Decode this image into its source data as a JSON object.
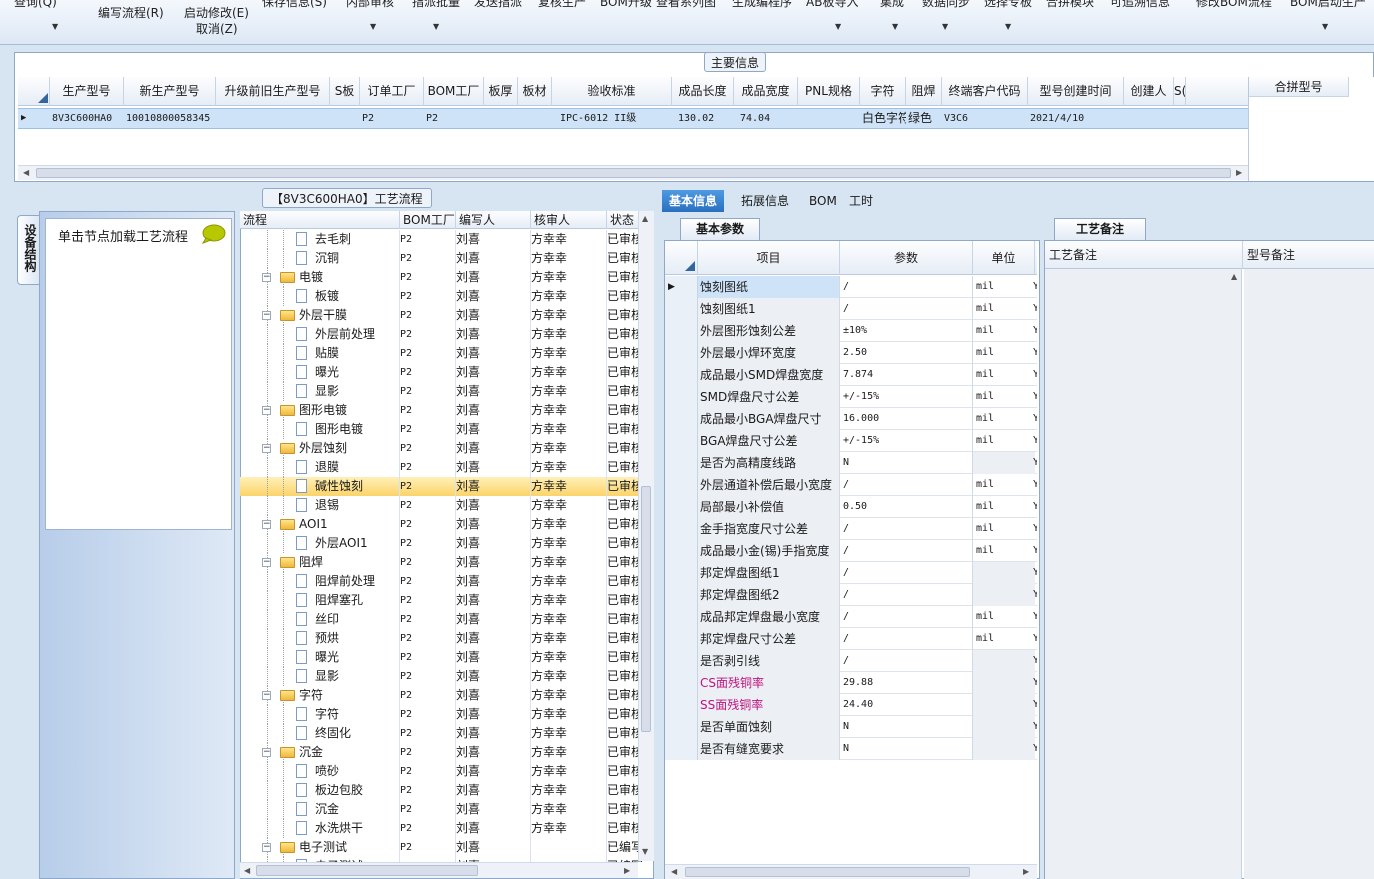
{
  "ribbon": {
    "top_partial": [
      "查询(Q)",
      "保存信息(S)",
      "内部审核",
      "指派批量",
      "发送指派",
      "复核生产",
      "BOM升级",
      "查看系列图",
      "生成编程序",
      "AB板导入",
      "集成",
      "数据同步",
      "选择专板",
      "合拼模块",
      "可追溯信息",
      "修改BOM流程",
      "BOM启动生产"
    ],
    "write_flow": "编写流程(R)",
    "start_modify": "启动修改(E)",
    "cancel": "取消(Z)"
  },
  "main_info": {
    "title": "主要信息",
    "columns": [
      "生产型号",
      "新生产型号",
      "升级前旧生产型号",
      "S板",
      "订单工厂",
      "BOM工厂",
      "板厚",
      "板材",
      "验收标准",
      "成品长度",
      "成品宽度",
      "PNL规格",
      "字符",
      "阻焊",
      "终端客户代码",
      "型号创建时间",
      "创建人",
      "S("
    ],
    "row": {
      "prod_no": "8V3C600HA0",
      "new_prod_no": "10010800058345",
      "old_prod_no": "",
      "s_board": "",
      "order_factory": "P2",
      "bom_factory": "P2",
      "thickness": "",
      "material": "",
      "standard": "IPC-6012 II级",
      "length": "130.02",
      "width": "74.04",
      "pnl": "",
      "char": "白色字符",
      "mask": "绿色",
      "customer_code": "V3C6",
      "created": "2021/4/10",
      "creator": ""
    },
    "merge_col_title": "合拼型号"
  },
  "left_panel": {
    "tab_label": "设备结构",
    "click_hint": "单击节点加载工艺流程"
  },
  "process": {
    "title": "【8V3C600HA0】工艺流程",
    "columns": [
      "流程",
      "BOM工厂",
      "编写人",
      "核审人",
      "状态"
    ],
    "rows": [
      {
        "name": "去毛刺",
        "type": "doc",
        "level": 2,
        "bom": "P2",
        "writer": "刘喜",
        "reviewer": "方幸幸",
        "status": "已审核"
      },
      {
        "name": "沉铜",
        "type": "doc",
        "level": 2,
        "bom": "P2",
        "writer": "刘喜",
        "reviewer": "方幸幸",
        "status": "已审核"
      },
      {
        "name": "电镀",
        "type": "folder",
        "level": 1,
        "bom": "P2",
        "writer": "刘喜",
        "reviewer": "方幸幸",
        "status": "已审核"
      },
      {
        "name": "板镀",
        "type": "doc",
        "level": 2,
        "bom": "P2",
        "writer": "刘喜",
        "reviewer": "方幸幸",
        "status": "已审核"
      },
      {
        "name": "外层干膜",
        "type": "folder",
        "level": 1,
        "bom": "P2",
        "writer": "刘喜",
        "reviewer": "方幸幸",
        "status": "已审核"
      },
      {
        "name": "外层前处理",
        "type": "doc",
        "level": 2,
        "bom": "P2",
        "writer": "刘喜",
        "reviewer": "方幸幸",
        "status": "已审核"
      },
      {
        "name": "贴膜",
        "type": "doc",
        "level": 2,
        "bom": "P2",
        "writer": "刘喜",
        "reviewer": "方幸幸",
        "status": "已审核"
      },
      {
        "name": "曝光",
        "type": "doc",
        "level": 2,
        "bom": "P2",
        "writer": "刘喜",
        "reviewer": "方幸幸",
        "status": "已审核"
      },
      {
        "name": "显影",
        "type": "doc",
        "level": 2,
        "bom": "P2",
        "writer": "刘喜",
        "reviewer": "方幸幸",
        "status": "已审核"
      },
      {
        "name": "图形电镀",
        "type": "folder",
        "level": 1,
        "bom": "P2",
        "writer": "刘喜",
        "reviewer": "方幸幸",
        "status": "已审核"
      },
      {
        "name": "图形电镀",
        "type": "doc",
        "level": 2,
        "bom": "P2",
        "writer": "刘喜",
        "reviewer": "方幸幸",
        "status": "已审核"
      },
      {
        "name": "外层蚀刻",
        "type": "folder",
        "level": 1,
        "bom": "P2",
        "writer": "刘喜",
        "reviewer": "方幸幸",
        "status": "已审核"
      },
      {
        "name": "退膜",
        "type": "doc",
        "level": 2,
        "bom": "P2",
        "writer": "刘喜",
        "reviewer": "方幸幸",
        "status": "已审核"
      },
      {
        "name": "碱性蚀刻",
        "type": "doc",
        "level": 2,
        "bom": "P2",
        "writer": "刘喜",
        "reviewer": "方幸幸",
        "status": "已审核",
        "selected": true
      },
      {
        "name": "退锡",
        "type": "doc",
        "level": 2,
        "bom": "P2",
        "writer": "刘喜",
        "reviewer": "方幸幸",
        "status": "已审核"
      },
      {
        "name": "AOI1",
        "type": "folder",
        "level": 1,
        "bom": "P2",
        "writer": "刘喜",
        "reviewer": "方幸幸",
        "status": "已审核"
      },
      {
        "name": "外层AOI1",
        "type": "doc",
        "level": 2,
        "bom": "P2",
        "writer": "刘喜",
        "reviewer": "方幸幸",
        "status": "已审核"
      },
      {
        "name": "阻焊",
        "type": "folder",
        "level": 1,
        "bom": "P2",
        "writer": "刘喜",
        "reviewer": "方幸幸",
        "status": "已审核"
      },
      {
        "name": "阻焊前处理",
        "type": "doc",
        "level": 2,
        "bom": "P2",
        "writer": "刘喜",
        "reviewer": "方幸幸",
        "status": "已审核"
      },
      {
        "name": "阻焊塞孔",
        "type": "doc",
        "level": 2,
        "bom": "P2",
        "writer": "刘喜",
        "reviewer": "方幸幸",
        "status": "已审核"
      },
      {
        "name": "丝印",
        "type": "doc",
        "level": 2,
        "bom": "P2",
        "writer": "刘喜",
        "reviewer": "方幸幸",
        "status": "已审核"
      },
      {
        "name": "预烘",
        "type": "doc",
        "level": 2,
        "bom": "P2",
        "writer": "刘喜",
        "reviewer": "方幸幸",
        "status": "已审核"
      },
      {
        "name": "曝光",
        "type": "doc",
        "level": 2,
        "bom": "P2",
        "writer": "刘喜",
        "reviewer": "方幸幸",
        "status": "已审核"
      },
      {
        "name": "显影",
        "type": "doc",
        "level": 2,
        "bom": "P2",
        "writer": "刘喜",
        "reviewer": "方幸幸",
        "status": "已审核"
      },
      {
        "name": "字符",
        "type": "folder",
        "level": 1,
        "bom": "P2",
        "writer": "刘喜",
        "reviewer": "方幸幸",
        "status": "已审核"
      },
      {
        "name": "字符",
        "type": "doc",
        "level": 2,
        "bom": "P2",
        "writer": "刘喜",
        "reviewer": "方幸幸",
        "status": "已审核"
      },
      {
        "name": "终固化",
        "type": "doc",
        "level": 2,
        "bom": "P2",
        "writer": "刘喜",
        "reviewer": "方幸幸",
        "status": "已审核"
      },
      {
        "name": "沉金",
        "type": "folder",
        "level": 1,
        "bom": "P2",
        "writer": "刘喜",
        "reviewer": "方幸幸",
        "status": "已审核"
      },
      {
        "name": "喷砂",
        "type": "doc",
        "level": 2,
        "bom": "P2",
        "writer": "刘喜",
        "reviewer": "方幸幸",
        "status": "已审核"
      },
      {
        "name": "板边包胶",
        "type": "doc",
        "level": 2,
        "bom": "P2",
        "writer": "刘喜",
        "reviewer": "方幸幸",
        "status": "已审核"
      },
      {
        "name": "沉金",
        "type": "doc",
        "level": 2,
        "bom": "P2",
        "writer": "刘喜",
        "reviewer": "方幸幸",
        "status": "已审核"
      },
      {
        "name": "水洗烘干",
        "type": "doc",
        "level": 2,
        "bom": "P2",
        "writer": "刘喜",
        "reviewer": "方幸幸",
        "status": "已审核"
      },
      {
        "name": "电子测试",
        "type": "folder",
        "level": 1,
        "bom": "P2",
        "writer": "刘喜",
        "reviewer": "",
        "status": "已编写"
      },
      {
        "name": "电子测试",
        "type": "doc",
        "level": 2,
        "bom": "P2",
        "writer": "刘喜",
        "reviewer": "",
        "status": "已编写"
      }
    ]
  },
  "right_tabs": [
    "基本信息",
    "拓展信息",
    "BOM",
    "工时"
  ],
  "base_params": {
    "tab": "基本参数",
    "columns": [
      "项目",
      "参数",
      "单位"
    ],
    "rows": [
      {
        "item": "蚀刻图纸",
        "param": "/",
        "unit": "mil",
        "trail": "Y"
      },
      {
        "item": "蚀刻图纸1",
        "param": "/",
        "unit": "mil",
        "trail": "Y"
      },
      {
        "item": "外层图形蚀刻公差",
        "param": "±10%",
        "unit": "mil",
        "trail": "Y"
      },
      {
        "item": "外层最小焊环宽度",
        "param": "2.50",
        "unit": "mil",
        "trail": "Y"
      },
      {
        "item": "成品最小SMD焊盘宽度",
        "param": "7.874",
        "unit": "mil",
        "trail": "Y"
      },
      {
        "item": "SMD焊盘尺寸公差",
        "param": "+/-15%",
        "unit": "mil",
        "trail": "Y"
      },
      {
        "item": "成品最小BGA焊盘尺寸",
        "param": "16.000",
        "unit": "mil",
        "trail": "Y"
      },
      {
        "item": "BGA焊盘尺寸公差",
        "param": "+/-15%",
        "unit": "mil",
        "trail": "Y"
      },
      {
        "item": "是否为高精度线路",
        "param": "N",
        "unit": "",
        "trail": "Y"
      },
      {
        "item": "外层通道补偿后最小宽度",
        "param": "/",
        "unit": "mil",
        "trail": "Y"
      },
      {
        "item": "局部最小补偿值",
        "param": "0.50",
        "unit": "mil",
        "trail": "Y"
      },
      {
        "item": "金手指宽度尺寸公差",
        "param": "/",
        "unit": "mil",
        "trail": "Y"
      },
      {
        "item": "成品最小金(锡)手指宽度",
        "param": "/",
        "unit": "mil",
        "trail": "Y"
      },
      {
        "item": "邦定焊盘图纸1",
        "param": "/",
        "unit": "",
        "trail": "Y"
      },
      {
        "item": "邦定焊盘图纸2",
        "param": "/",
        "unit": "",
        "trail": "Y"
      },
      {
        "item": "成品邦定焊盘最小宽度",
        "param": "/",
        "unit": "mil",
        "trail": "Y"
      },
      {
        "item": "邦定焊盘尺寸公差",
        "param": "/",
        "unit": "mil",
        "trail": "Y"
      },
      {
        "item": "是否剥引线",
        "param": "/",
        "unit": "",
        "trail": "Y"
      },
      {
        "item": "CS面残铜率",
        "param": "29.88",
        "unit": "",
        "trail": "Y",
        "pink": true
      },
      {
        "item": "SS面残铜率",
        "param": "24.40",
        "unit": "",
        "trail": "Y",
        "pink": true
      },
      {
        "item": "是否单面蚀刻",
        "param": "N",
        "unit": "",
        "trail": "Y"
      },
      {
        "item": "是否有缝宽要求",
        "param": "N",
        "unit": "",
        "trail": "Y"
      }
    ]
  },
  "craft_notes": {
    "tab": "工艺备注",
    "col1": "工艺备注",
    "col2": "型号备注"
  }
}
